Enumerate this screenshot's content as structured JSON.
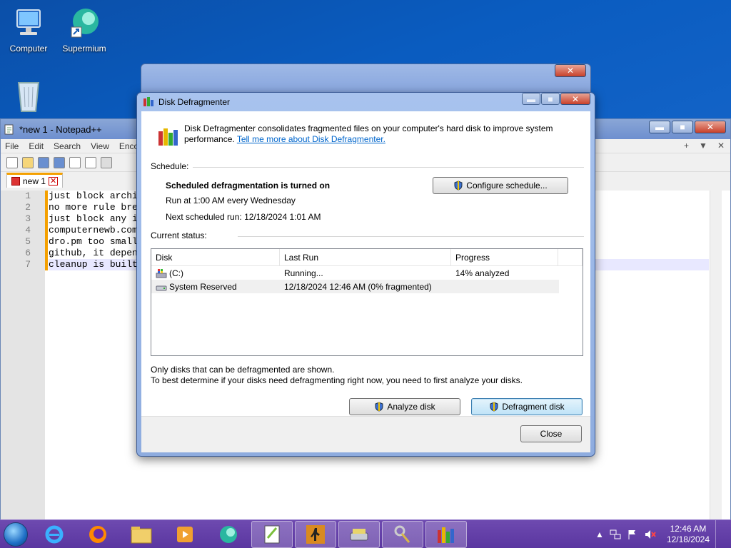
{
  "desktop": {
    "icons": [
      {
        "label": "Computer"
      },
      {
        "label": "Supermium"
      },
      {
        "label": "Recycle Bin"
      }
    ]
  },
  "notepad": {
    "title": "*new 1 - Notepad++",
    "menu": [
      "File",
      "Edit",
      "Search",
      "View",
      "Enco"
    ],
    "tab_label": "new 1",
    "line_numbers": [
      "1",
      "2",
      "3",
      "4",
      "5",
      "6",
      "7"
    ],
    "lines": [
      "just block archi",
      "no more rule bre",
      "just block any i",
      "computernewb.com",
      "dro.pm too small",
      "github, it depen",
      "cleanup is built"
    ],
    "right_ctrls": [
      "+",
      "▼",
      "✕"
    ]
  },
  "dialog": {
    "title": "Disk Defragmenter",
    "intro_text": "Disk Defragmenter consolidates fragmented files on your computer's hard disk to improve system performance.",
    "intro_link": "Tell me more about Disk Defragmenter.",
    "schedule_header": "Schedule:",
    "schedule_status": "Scheduled defragmentation is turned on",
    "schedule_run": "Run at 1:00 AM every Wednesday",
    "schedule_next": "Next scheduled run: 12/18/2024 1:01 AM",
    "configure_button": "Configure schedule...",
    "status_header": "Current status:",
    "columns": [
      "Disk",
      "Last Run",
      "Progress"
    ],
    "disks": [
      {
        "disk": "(C:)",
        "last_run": "Running...",
        "progress": "14% analyzed"
      },
      {
        "disk": "System Reserved",
        "last_run": "12/18/2024 12:46 AM (0% fragmented)",
        "progress": ""
      }
    ],
    "note_line1": "Only disks that can be defragmented are shown.",
    "note_line2": "To best determine if your disks need defragmenting right now, you need to first analyze your disks.",
    "analyze_button": "Analyze disk",
    "defragment_button": "Defragment disk",
    "close_button": "Close"
  },
  "taskbar": {
    "time": "12:46 AM",
    "date": "12/18/2024"
  },
  "colors": {
    "desktop": "#0b4fa8",
    "taskbar": "#5a36a0",
    "link": "#0066cc",
    "tab_accent": "#f4a000"
  }
}
